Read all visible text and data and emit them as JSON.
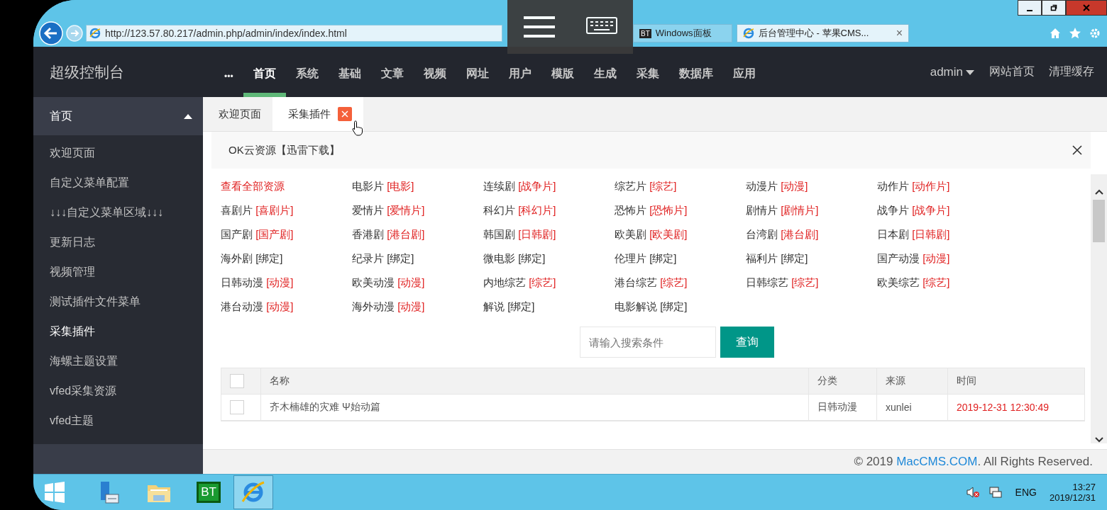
{
  "browser": {
    "url": "http://123.57.80.217/admin.php/admin/index/index.html",
    "tabs": [
      {
        "badge": "BT",
        "title": "Windows面板",
        "selected": false,
        "closable": false
      },
      {
        "title": "后台管理中心 - 苹果CMS...",
        "selected": true,
        "closable": true,
        "close": "×"
      }
    ]
  },
  "header": {
    "title": "超级控制台",
    "more": "•••",
    "nav": [
      {
        "label": "首页",
        "selected": true
      },
      {
        "label": "系统",
        "selected": false
      },
      {
        "label": "基础",
        "selected": false
      },
      {
        "label": "文章",
        "selected": false
      },
      {
        "label": "视频",
        "selected": false
      },
      {
        "label": "网址",
        "selected": false
      },
      {
        "label": "用户",
        "selected": false
      },
      {
        "label": "模版",
        "selected": false
      },
      {
        "label": "生成",
        "selected": false
      },
      {
        "label": "采集",
        "selected": false
      },
      {
        "label": "数据库",
        "selected": false
      },
      {
        "label": "应用",
        "selected": false
      }
    ],
    "user": "admin",
    "links": [
      "网站首页",
      "清理缓存"
    ]
  },
  "sidebar": {
    "group": {
      "label": "首页",
      "expanded": true
    },
    "items": [
      {
        "label": "欢迎页面",
        "selected": false
      },
      {
        "label": "自定义菜单配置",
        "selected": false
      },
      {
        "label": "↓↓↓自定义菜单区域↓↓↓",
        "selected": false
      },
      {
        "label": "更新日志",
        "selected": false
      },
      {
        "label": "视频管理",
        "selected": false
      },
      {
        "label": "测试插件文件菜单",
        "selected": false
      },
      {
        "label": "采集插件",
        "selected": true
      },
      {
        "label": "海螺主题设置",
        "selected": false
      },
      {
        "label": "vfed采集资源",
        "selected": false
      },
      {
        "label": "vfed主题",
        "selected": false
      }
    ]
  },
  "tabs": [
    {
      "label": "欢迎页面",
      "selected": false,
      "closable": false
    },
    {
      "label": "采集插件",
      "selected": true,
      "closable": true
    }
  ],
  "panel": {
    "title": "OK云资源【迅雷下载】",
    "categories": [
      {
        "kind": "all",
        "name": "查看全部资源"
      },
      {
        "kind": "category",
        "name": "电影片",
        "tag": "[电影]",
        "bound": true
      },
      {
        "kind": "category",
        "name": "连续剧",
        "tag": "[战争片]",
        "bound": true
      },
      {
        "kind": "category",
        "name": "综艺片",
        "tag": "[综艺]",
        "bound": true
      },
      {
        "kind": "category",
        "name": "动漫片",
        "tag": "[动漫]",
        "bound": true
      },
      {
        "kind": "category",
        "name": "动作片",
        "tag": "[动作片]",
        "bound": true
      },
      {
        "kind": "category",
        "name": "喜剧片",
        "tag": "[喜剧片]",
        "bound": true
      },
      {
        "kind": "category",
        "name": "爱情片",
        "tag": "[爱情片]",
        "bound": true
      },
      {
        "kind": "category",
        "name": "科幻片",
        "tag": "[科幻片]",
        "bound": true
      },
      {
        "kind": "category",
        "name": "恐怖片",
        "tag": "[恐怖片]",
        "bound": true
      },
      {
        "kind": "category",
        "name": "剧情片",
        "tag": "[剧情片]",
        "bound": true
      },
      {
        "kind": "category",
        "name": "战争片",
        "tag": "[战争片]",
        "bound": true
      },
      {
        "kind": "category",
        "name": "国产剧",
        "tag": "[国产剧]",
        "bound": true
      },
      {
        "kind": "category",
        "name": "香港剧",
        "tag": "[港台剧]",
        "bound": true
      },
      {
        "kind": "category",
        "name": "韩国剧",
        "tag": "[日韩剧]",
        "bound": true
      },
      {
        "kind": "category",
        "name": "欧美剧",
        "tag": "[欧美剧]",
        "bound": true
      },
      {
        "kind": "category",
        "name": "台湾剧",
        "tag": "[港台剧]",
        "bound": true
      },
      {
        "kind": "category",
        "name": "日本剧",
        "tag": "[日韩剧]",
        "bound": true
      },
      {
        "kind": "category",
        "name": "海外剧",
        "tag": "[绑定]",
        "bound": false
      },
      {
        "kind": "category",
        "name": "纪录片",
        "tag": "[绑定]",
        "bound": false
      },
      {
        "kind": "category",
        "name": "微电影",
        "tag": "[绑定]",
        "bound": false
      },
      {
        "kind": "category",
        "name": "伦理片",
        "tag": "[绑定]",
        "bound": false
      },
      {
        "kind": "category",
        "name": "福利片",
        "tag": "[绑定]",
        "bound": false
      },
      {
        "kind": "category",
        "name": "国产动漫",
        "tag": "[动漫]",
        "bound": true
      },
      {
        "kind": "category",
        "name": "日韩动漫",
        "tag": "[动漫]",
        "bound": true
      },
      {
        "kind": "category",
        "name": "欧美动漫",
        "tag": "[动漫]",
        "bound": true
      },
      {
        "kind": "category",
        "name": "内地综艺",
        "tag": "[综艺]",
        "bound": true
      },
      {
        "kind": "category",
        "name": "港台综艺",
        "tag": "[综艺]",
        "bound": true
      },
      {
        "kind": "category",
        "name": "日韩综艺",
        "tag": "[综艺]",
        "bound": true
      },
      {
        "kind": "category",
        "name": "欧美综艺",
        "tag": "[综艺]",
        "bound": true
      },
      {
        "kind": "category",
        "name": "港台动漫",
        "tag": "[动漫]",
        "bound": true
      },
      {
        "kind": "category",
        "name": "海外动漫",
        "tag": "[动漫]",
        "bound": true
      },
      {
        "kind": "category",
        "name": "解说",
        "tag": "[绑定]",
        "bound": false
      },
      {
        "kind": "category",
        "name": "电影解说",
        "tag": "[绑定]",
        "bound": false
      }
    ],
    "search": {
      "placeholder": "请输入搜索条件",
      "button": "查询"
    },
    "table": {
      "select_all": {
        "checked": false
      },
      "columns": [
        "名称",
        "分类",
        "来源",
        "时间"
      ],
      "rows": [
        {
          "checked": false,
          "name": "齐木楠雄的灾难 Ψ始动篇",
          "category": "日韩动漫",
          "source": "xunlei",
          "time": "2019-12-31 12:30:49"
        }
      ]
    }
  },
  "footer": {
    "prefix": "© 2019 ",
    "link": "MacCMS.COM",
    "suffix": ". All Rights Reserved."
  },
  "taskbar": {
    "apps": [
      {
        "kind": "server",
        "selected": false
      },
      {
        "kind": "explorer",
        "selected": false
      },
      {
        "kind": "bt",
        "label": "BT",
        "selected": false
      },
      {
        "kind": "ie",
        "selected": true
      }
    ],
    "language": "ENG",
    "time": "13:27",
    "date": "2019/12/31"
  }
}
